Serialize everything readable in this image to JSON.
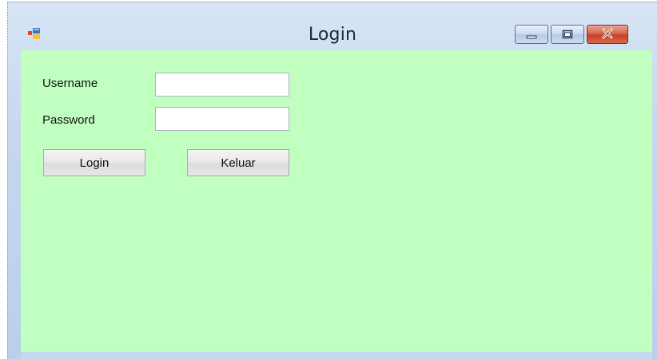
{
  "window": {
    "title": "Login",
    "icon": "winforms-app-icon",
    "controls": {
      "minimize_icon": "minimize-icon",
      "maximize_icon": "maximize-icon",
      "close_icon": "close-icon"
    }
  },
  "form": {
    "background_color": "#c0ffc0",
    "username_label": "Username",
    "username_value": "",
    "password_label": "Password",
    "password_value": "",
    "login_button": "Login",
    "exit_button": "Keluar"
  }
}
